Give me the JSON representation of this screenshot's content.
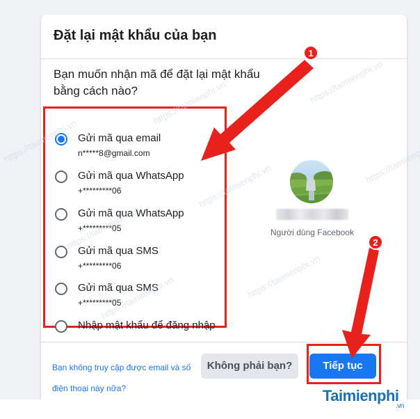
{
  "dialog": {
    "title": "Đặt lại mật khẩu của bạn",
    "question": "Bạn muốn nhận mã để đặt lại mật khẩu bằng cách nào?",
    "options": [
      {
        "label": "Gửi mã qua email",
        "detail": "n*****8@gmail.com",
        "checked": true
      },
      {
        "label": "Gửi mã qua WhatsApp",
        "detail": "+*********06",
        "checked": false
      },
      {
        "label": "Gửi mã qua WhatsApp",
        "detail": "+*********05",
        "checked": false
      },
      {
        "label": "Gửi mã qua SMS",
        "detail": "+*********06",
        "checked": false
      },
      {
        "label": "Gửi mã qua SMS",
        "detail": "+*********05",
        "checked": false
      },
      {
        "label": "Nhập mật khẩu để đăng nhập",
        "detail": "",
        "checked": false
      }
    ],
    "profile": {
      "caption": "Người dùng Facebook"
    },
    "help_link": "Bạn không truy cập được email và số điện thoại này nữa?",
    "not_you_button": "Không phải bạn?",
    "continue_button": "Tiếp tục"
  },
  "annotations": {
    "marker1": "1",
    "marker2": "2"
  },
  "watermark": {
    "text": "https://taimienphi.vn",
    "logo": "Taimienphi",
    "logo_suffix": ".vn"
  },
  "colors": {
    "accent": "#1877f2",
    "highlight": "#e8211d",
    "marker": "#e8211d"
  },
  "icons": {
    "radio_selected": "radio-selected-icon",
    "radio_unselected": "radio-unselected-icon"
  }
}
